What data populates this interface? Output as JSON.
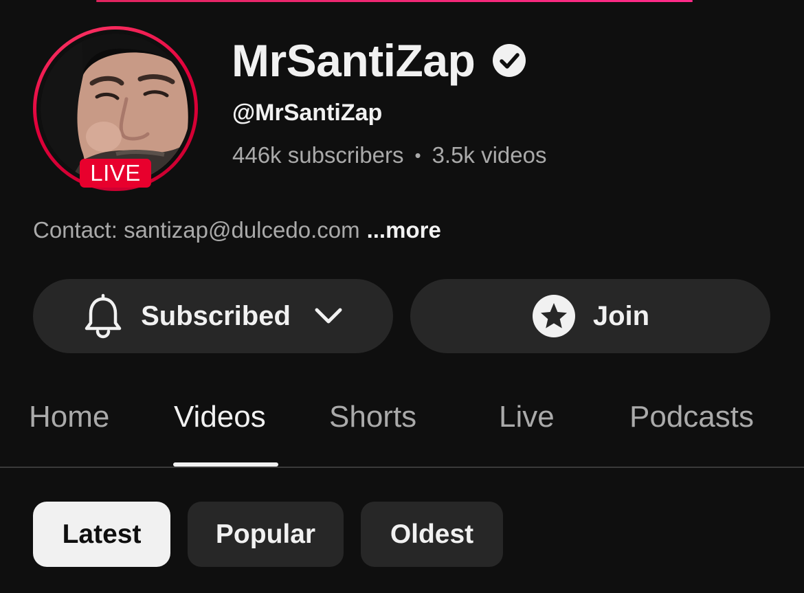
{
  "channel": {
    "name": "MrSantiZap",
    "handle": "@MrSantiZap",
    "subscribers": "446k subscribers",
    "separator": "•",
    "videos": "3.5k videos",
    "live_badge": "LIVE",
    "description": "Contact: santizap@dulcedo.com",
    "more_link": "...more",
    "verified_icon": "verified-check-icon"
  },
  "actions": {
    "subscribe_label": "Subscribed",
    "subscribe_icon": "bell-icon",
    "subscribe_menu_icon": "chevron-down-icon",
    "join_label": "Join",
    "join_icon": "star-icon"
  },
  "tabs": [
    {
      "label": "Home",
      "active": false
    },
    {
      "label": "Videos",
      "active": true
    },
    {
      "label": "Shorts",
      "active": false
    },
    {
      "label": "Live",
      "active": false
    },
    {
      "label": "Podcasts",
      "active": false
    }
  ],
  "sort_chips": [
    {
      "label": "Latest",
      "selected": true
    },
    {
      "label": "Popular",
      "selected": false
    },
    {
      "label": "Oldest",
      "selected": false
    }
  ],
  "colors": {
    "background": "#0f0f0f",
    "live_red": "#e8002d",
    "surface": "#272727",
    "secondary_text": "#aaaaaa"
  }
}
